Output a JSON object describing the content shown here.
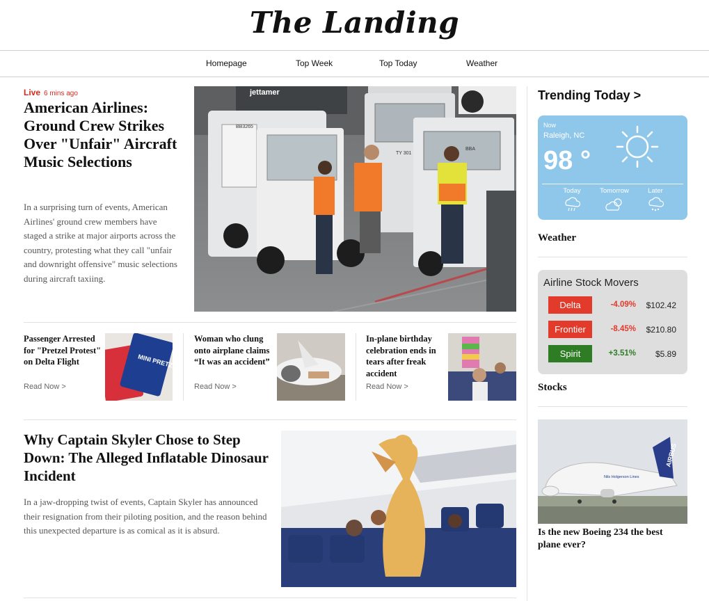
{
  "masthead": {
    "title": "The Landing"
  },
  "nav": {
    "items": [
      "Homepage",
      "Top Week",
      "Top Today",
      "Weather"
    ]
  },
  "hero": {
    "live_label": "Live",
    "time_ago": "6 mins ago",
    "title": "American Airlines: Ground Crew Strikes Over \"Unfair\" Aircraft Music Selections",
    "body": "In a surprising turn of events, American Airlines' ground crew members have staged a strike at major airports across the country, protesting what they call \"unfair and downright offensive\" music selections during aircraft taxiing.",
    "image_text": {
      "jet": "jettamer",
      "tug1": "BB3265",
      "tug2": "TY 301",
      "tug3": "BBA"
    }
  },
  "small_stories": [
    {
      "title": "Passenger Arrested for \"Pretzel Protest\" on Delta Flight",
      "link": "Read Now >",
      "image_text": "MINI PRETZEL"
    },
    {
      "title": "Woman who clung onto airplane claims “It was an accident”",
      "link": "Read Now >"
    },
    {
      "title": "In-plane birthday celebration ends in tears after freak accident",
      "link": "Read Now >"
    }
  ],
  "feature": {
    "title": "Why Captain Skyler Chose to Step Down: The Alleged Inflatable Dinosaur Incident",
    "body": "In a jaw-dropping twist of events, Captain Skyler has announced their resignation from their piloting position, and the reason behind this unexpected departure is as comical as it is absurd."
  },
  "sidebar": {
    "trending": "Trending Today >",
    "weather_card": {
      "now": "Now",
      "location": "Raleigh, NC",
      "temp": "98 °",
      "forecast": [
        "Today",
        "Tomorrow",
        "Later"
      ],
      "icons": [
        "sun-icon",
        "rain-icon",
        "partly-cloudy-icon",
        "snow-icon"
      ]
    },
    "weather_heading": "Weather",
    "stocks_card": {
      "title": "Airline Stock Movers",
      "rows": [
        {
          "name": "Delta",
          "change": "-4.09%",
          "price": "$102.42",
          "color": "#e23a2b"
        },
        {
          "name": "Frontier",
          "change": "-8.45%",
          "price": "$210.80",
          "color": "#e23a2b"
        },
        {
          "name": "Spirit",
          "change": "+3.51%",
          "price": "$5.89",
          "color": "#2e7d25"
        }
      ]
    },
    "stocks_heading": "Stocks",
    "plane_story": {
      "title": "Is the new Boeing 234 the best plane ever?",
      "image_text": {
        "livery": "Nils Holgerson Lines",
        "tail": "AIRBUS"
      }
    }
  }
}
